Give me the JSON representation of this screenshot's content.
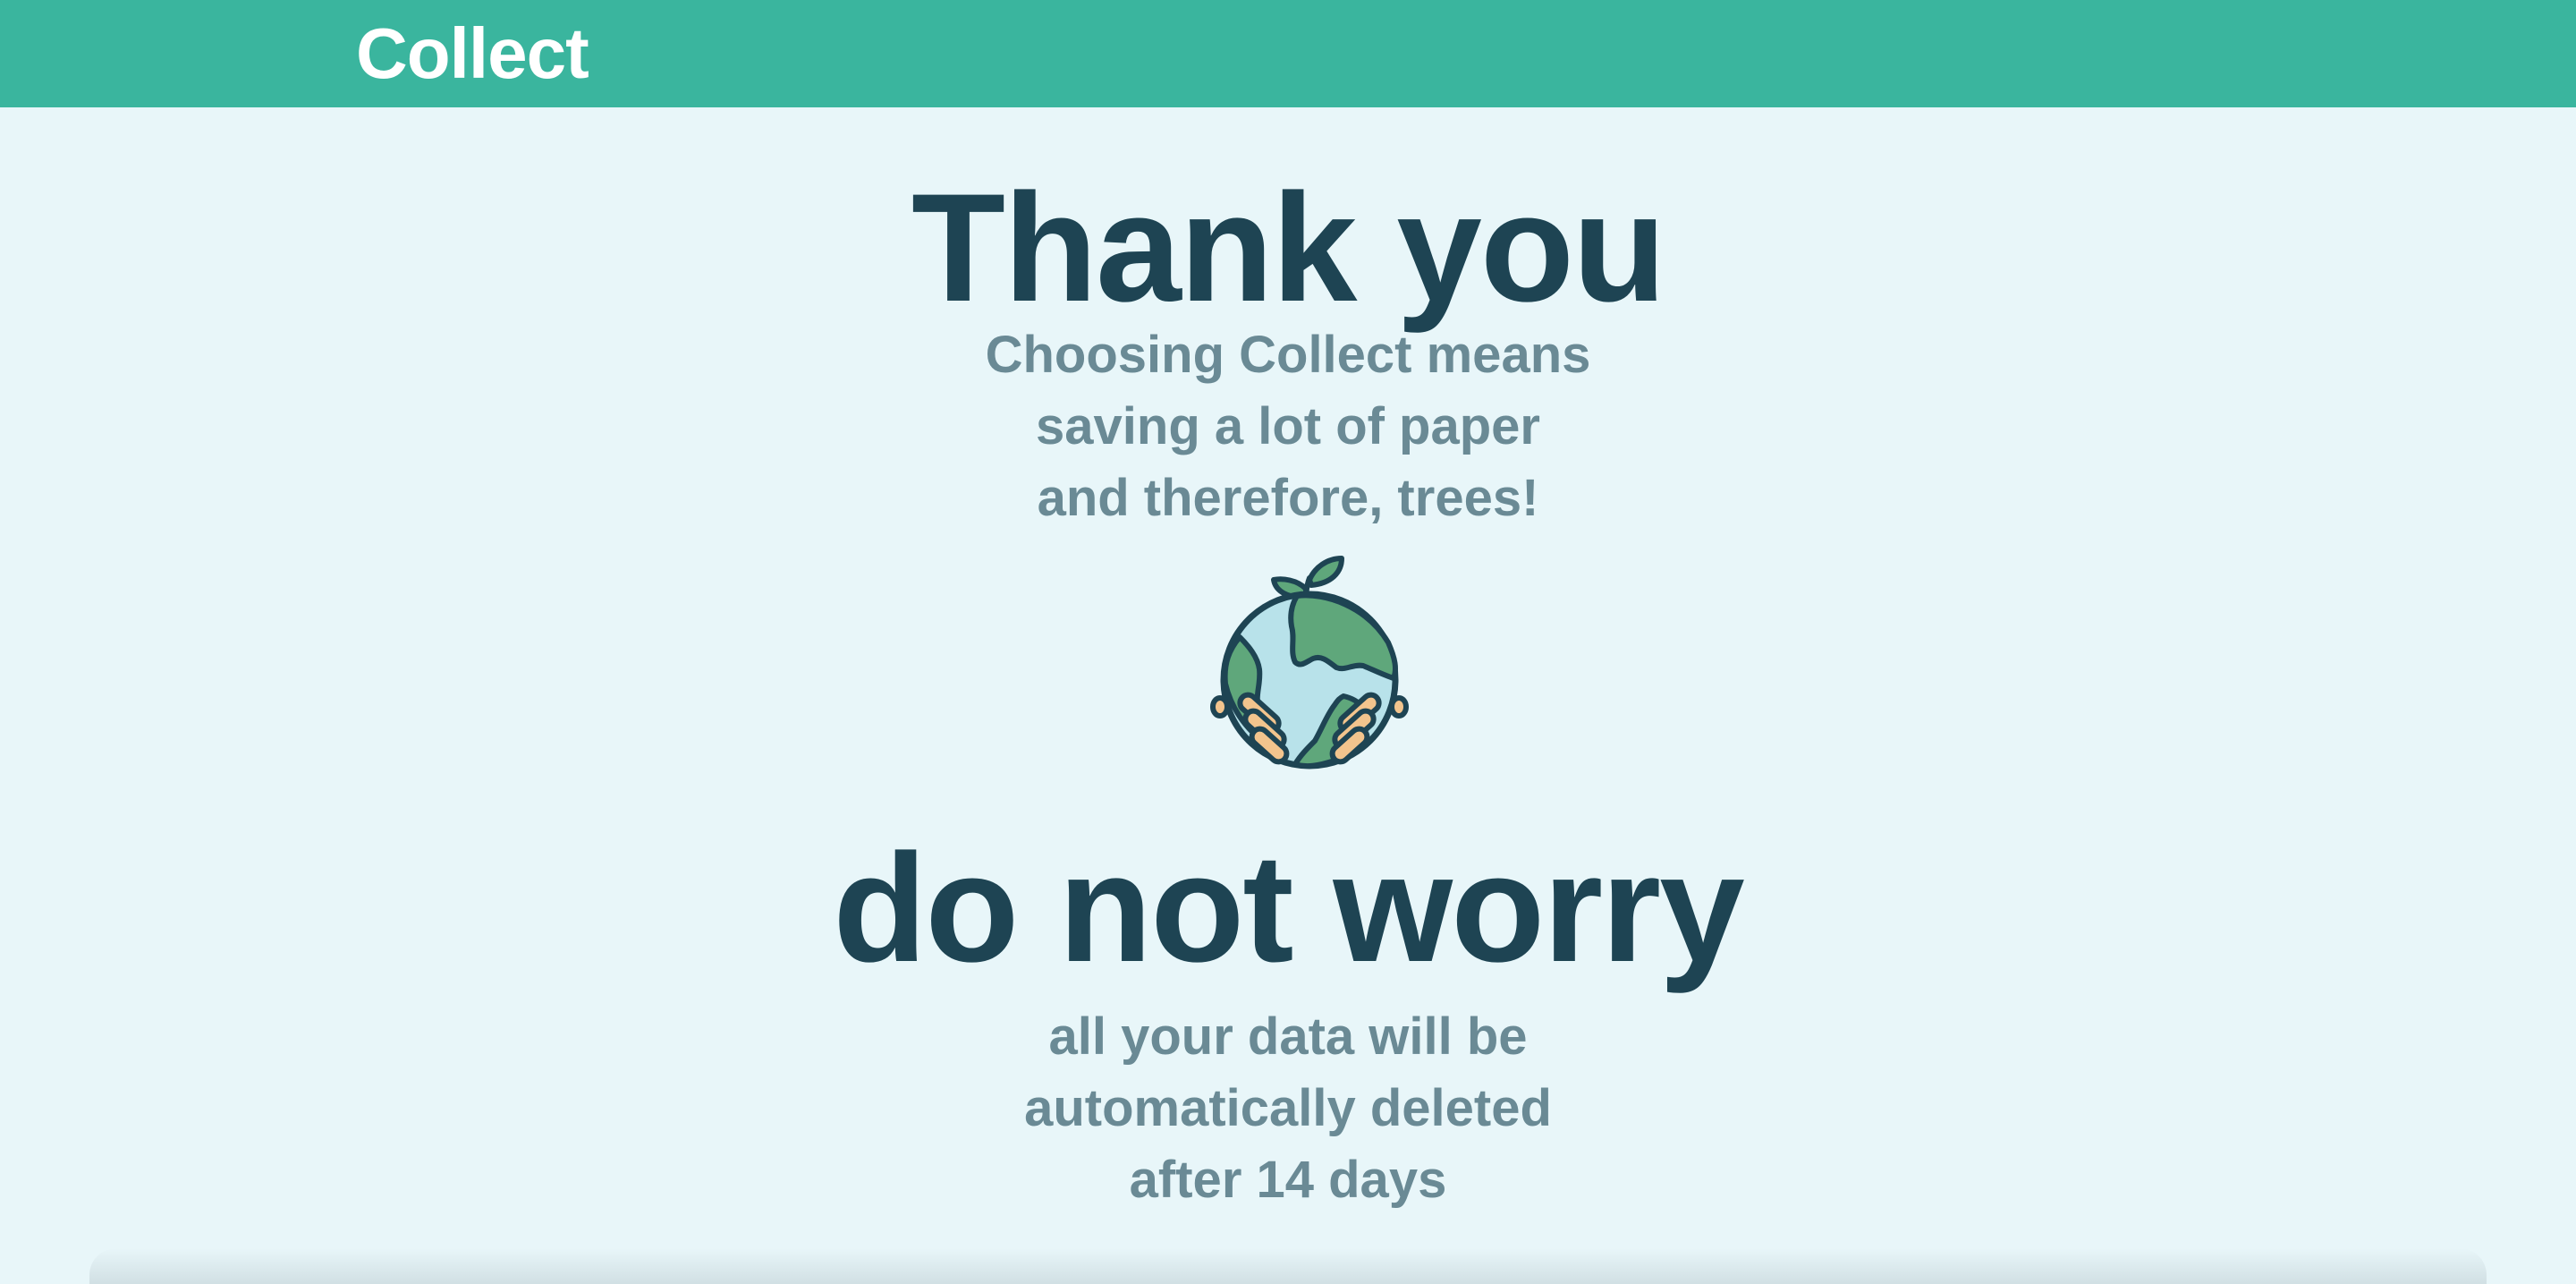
{
  "header": {
    "brand": "Collect",
    "background_color": "#3ab59e"
  },
  "main": {
    "title": "Thank you",
    "intro_lines": [
      "Choosing Collect means",
      "saving a lot of paper",
      "and therefore, trees!"
    ],
    "illustration_icon": "earth-in-hands-icon",
    "reassurance_title": "do not worry",
    "reassurance_lines": [
      "all your data will be",
      "automatically deleted",
      "after 14 days"
    ]
  },
  "colors": {
    "page_background": "#e8f6f9",
    "heading": "#1e4453",
    "subtext": "#6a8a95",
    "globe_water": "#b8e2ea",
    "globe_land": "#5fa77b",
    "hands": "#f2c48d",
    "outline": "#1e4453"
  }
}
